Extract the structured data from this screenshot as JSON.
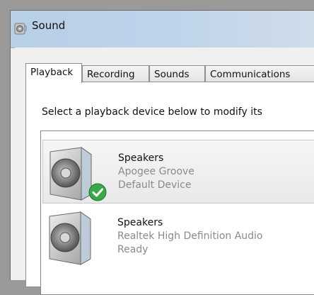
{
  "window": {
    "title": "Sound"
  },
  "tabs": [
    {
      "label": "Playback",
      "active": true
    },
    {
      "label": "Recording",
      "active": false
    },
    {
      "label": "Sounds",
      "active": false
    },
    {
      "label": "Communications",
      "active": false
    }
  ],
  "instruction": "Select a playback device below to modify its",
  "devices": [
    {
      "name": "Speakers",
      "description": "Apogee Groove",
      "status": "Default Device",
      "icon": "speaker-icon",
      "badge": "default-check-icon",
      "selected": true
    },
    {
      "name": "Speakers",
      "description": "Realtek High Definition Audio",
      "status": "Ready",
      "icon": "speaker-icon",
      "selected": false
    }
  ],
  "colors": {
    "check_badge": "#3aa84a",
    "title_bar": "#bcd3ea",
    "secondary_text": "#8a8a8a"
  }
}
